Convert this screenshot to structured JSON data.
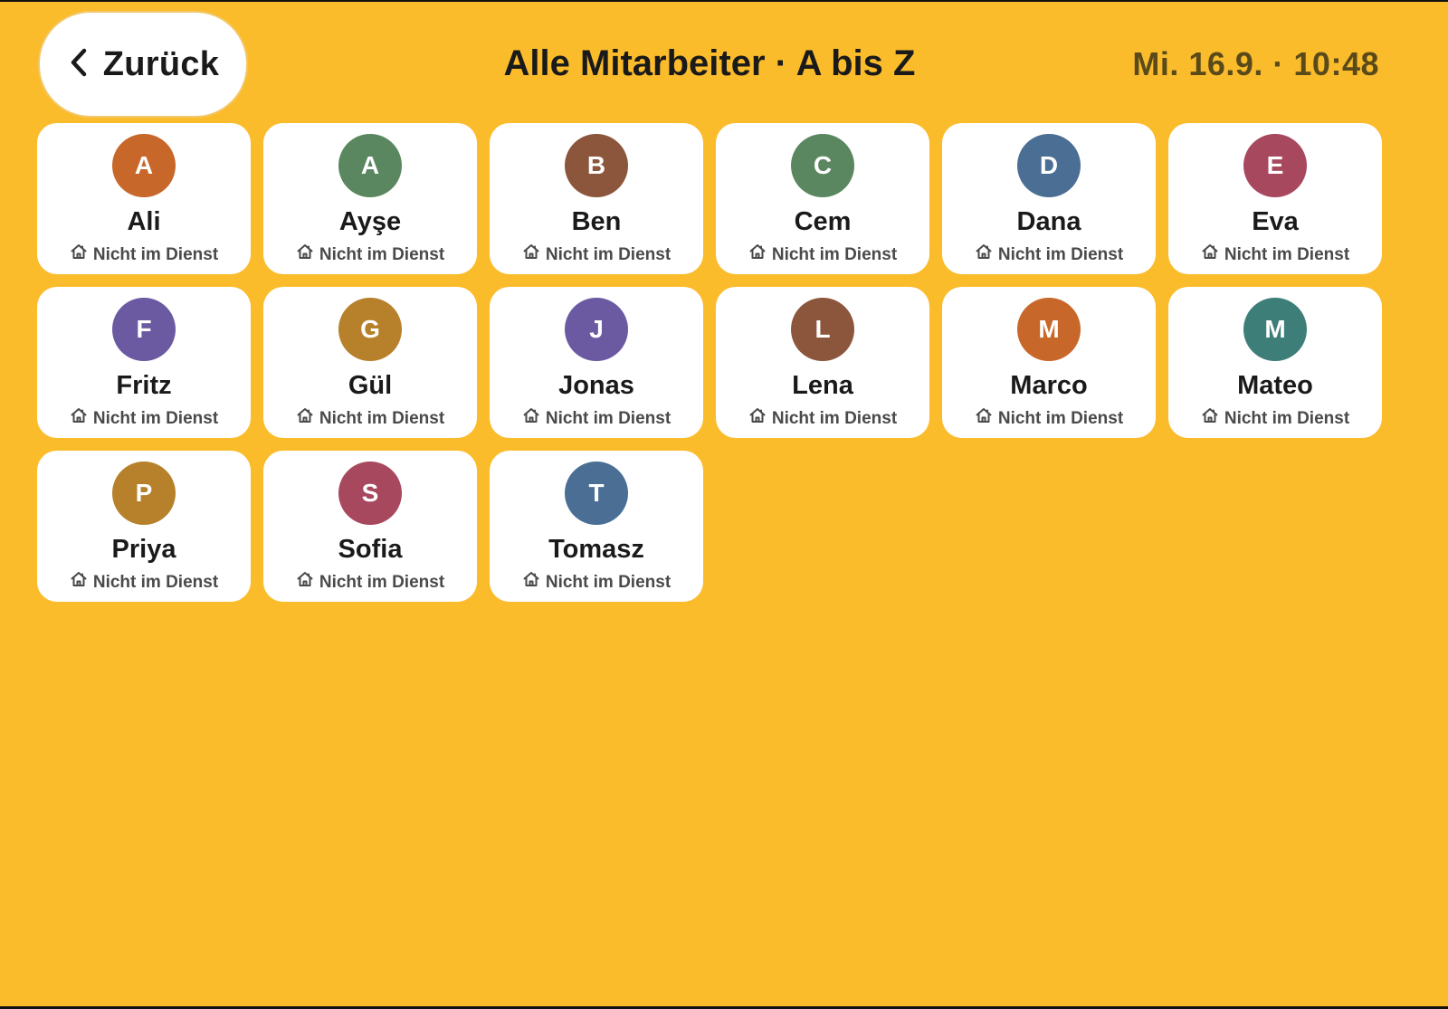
{
  "header": {
    "back_label": "Zurück",
    "title": "Alle Mitarbeiter · A bis Z",
    "datetime": "Mi. 16.9. · 10:48"
  },
  "colors": {
    "background": "#FBBC2C",
    "card": "#ffffff"
  },
  "employees": [
    {
      "initial": "A",
      "name": "Ali",
      "status": "Nicht im Dienst",
      "status_icon": "home-icon",
      "color": "#C8672A"
    },
    {
      "initial": "A",
      "name": "Ayşe",
      "status": "Nicht im Dienst",
      "status_icon": "home-icon",
      "color": "#5A8760"
    },
    {
      "initial": "B",
      "name": "Ben",
      "status": "Nicht im Dienst",
      "status_icon": "home-icon",
      "color": "#8B563B"
    },
    {
      "initial": "C",
      "name": "Cem",
      "status": "Nicht im Dienst",
      "status_icon": "home-icon",
      "color": "#5A8760"
    },
    {
      "initial": "D",
      "name": "Dana",
      "status": "Nicht im Dienst",
      "status_icon": "home-icon",
      "color": "#4A6E94"
    },
    {
      "initial": "E",
      "name": "Eva",
      "status": "Nicht im Dienst",
      "status_icon": "home-icon",
      "color": "#A8485E"
    },
    {
      "initial": "F",
      "name": "Fritz",
      "status": "Nicht im Dienst",
      "status_icon": "home-icon",
      "color": "#6B5AA2"
    },
    {
      "initial": "G",
      "name": "Gül",
      "status": "Nicht im Dienst",
      "status_icon": "home-icon",
      "color": "#B7812C"
    },
    {
      "initial": "J",
      "name": "Jonas",
      "status": "Nicht im Dienst",
      "status_icon": "home-icon",
      "color": "#6B5AA2"
    },
    {
      "initial": "L",
      "name": "Lena",
      "status": "Nicht im Dienst",
      "status_icon": "home-icon",
      "color": "#8B563B"
    },
    {
      "initial": "M",
      "name": "Marco",
      "status": "Nicht im Dienst",
      "status_icon": "home-icon",
      "color": "#C8672A"
    },
    {
      "initial": "M",
      "name": "Mateo",
      "status": "Nicht im Dienst",
      "status_icon": "home-icon",
      "color": "#3E7E78"
    },
    {
      "initial": "P",
      "name": "Priya",
      "status": "Nicht im Dienst",
      "status_icon": "home-icon",
      "color": "#B7812C"
    },
    {
      "initial": "S",
      "name": "Sofia",
      "status": "Nicht im Dienst",
      "status_icon": "home-icon",
      "color": "#A8485E"
    },
    {
      "initial": "T",
      "name": "Tomasz",
      "status": "Nicht im Dienst",
      "status_icon": "home-icon",
      "color": "#4A6E94"
    }
  ]
}
